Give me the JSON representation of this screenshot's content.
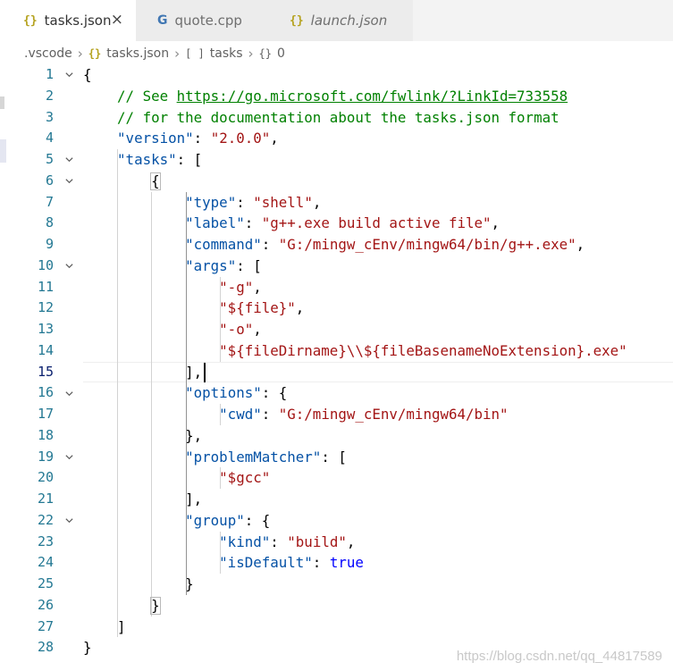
{
  "tabs": [
    {
      "label": "tasks.json",
      "icon": "{}",
      "icon_name": "json-file-icon",
      "active": true,
      "italic": false,
      "close": "×"
    },
    {
      "label": "quote.cpp",
      "icon": "G",
      "icon_name": "cpp-file-icon",
      "active": false,
      "italic": false
    },
    {
      "label": "launch.json",
      "icon": "{}",
      "icon_name": "json-file-icon",
      "active": false,
      "italic": true
    }
  ],
  "breadcrumb": [
    {
      "label": ".vscode",
      "icon": ""
    },
    {
      "label": "tasks.json",
      "icon": "{}"
    },
    {
      "label": "tasks",
      "icon": "[ ]"
    },
    {
      "label": "0",
      "icon": "{}"
    }
  ],
  "editor": {
    "current_line": 15,
    "lines": [
      {
        "n": "1",
        "fold": true,
        "tokens": [
          [
            "p",
            "{"
          ]
        ]
      },
      {
        "n": "2",
        "fold": false,
        "tokens": [
          [
            "p",
            "    "
          ],
          [
            "c",
            "// See "
          ],
          [
            "cl",
            "https://go.microsoft.com/fwlink/?LinkId=733558"
          ]
        ]
      },
      {
        "n": "3",
        "fold": false,
        "tokens": [
          [
            "p",
            "    "
          ],
          [
            "c",
            "// for the documentation about the tasks.json format"
          ]
        ]
      },
      {
        "n": "4",
        "fold": false,
        "tokens": [
          [
            "p",
            "    "
          ],
          [
            "k",
            "\"version\""
          ],
          [
            "p",
            ": "
          ],
          [
            "s",
            "\"2.0.0\""
          ],
          [
            "p",
            ","
          ]
        ]
      },
      {
        "n": "5",
        "fold": true,
        "tokens": [
          [
            "p",
            "    "
          ],
          [
            "k",
            "\"tasks\""
          ],
          [
            "p",
            ": ["
          ]
        ]
      },
      {
        "n": "6",
        "fold": true,
        "tokens": [
          [
            "p",
            "        {"
          ]
        ]
      },
      {
        "n": "7",
        "fold": false,
        "tokens": [
          [
            "p",
            "            "
          ],
          [
            "k",
            "\"type\""
          ],
          [
            "p",
            ": "
          ],
          [
            "s",
            "\"shell\""
          ],
          [
            "p",
            ","
          ]
        ]
      },
      {
        "n": "8",
        "fold": false,
        "tokens": [
          [
            "p",
            "            "
          ],
          [
            "k",
            "\"label\""
          ],
          [
            "p",
            ": "
          ],
          [
            "s",
            "\"g++.exe build active file\""
          ],
          [
            "p",
            ","
          ]
        ]
      },
      {
        "n": "9",
        "fold": false,
        "tokens": [
          [
            "p",
            "            "
          ],
          [
            "k",
            "\"command\""
          ],
          [
            "p",
            ": "
          ],
          [
            "s",
            "\"G:/mingw_cEnv/mingw64/bin/g++.exe\""
          ],
          [
            "p",
            ","
          ]
        ]
      },
      {
        "n": "10",
        "fold": true,
        "tokens": [
          [
            "p",
            "            "
          ],
          [
            "k",
            "\"args\""
          ],
          [
            "p",
            ": ["
          ]
        ]
      },
      {
        "n": "11",
        "fold": false,
        "tokens": [
          [
            "p",
            "                "
          ],
          [
            "s",
            "\"-g\""
          ],
          [
            "p",
            ","
          ]
        ]
      },
      {
        "n": "12",
        "fold": false,
        "tokens": [
          [
            "p",
            "                "
          ],
          [
            "s",
            "\"${file}\""
          ],
          [
            "p",
            ","
          ]
        ]
      },
      {
        "n": "13",
        "fold": false,
        "tokens": [
          [
            "p",
            "                "
          ],
          [
            "s",
            "\"-o\""
          ],
          [
            "p",
            ","
          ]
        ]
      },
      {
        "n": "14",
        "fold": false,
        "tokens": [
          [
            "p",
            "                "
          ],
          [
            "s",
            "\"${fileDirname}\\\\${fileBasenameNoExtension}.exe\""
          ]
        ]
      },
      {
        "n": "15",
        "fold": false,
        "tokens": [
          [
            "p",
            "            ],"
          ]
        ]
      },
      {
        "n": "16",
        "fold": true,
        "tokens": [
          [
            "p",
            "            "
          ],
          [
            "k",
            "\"options\""
          ],
          [
            "p",
            ": {"
          ]
        ]
      },
      {
        "n": "17",
        "fold": false,
        "tokens": [
          [
            "p",
            "                "
          ],
          [
            "k",
            "\"cwd\""
          ],
          [
            "p",
            ": "
          ],
          [
            "s",
            "\"G:/mingw_cEnv/mingw64/bin\""
          ]
        ]
      },
      {
        "n": "18",
        "fold": false,
        "tokens": [
          [
            "p",
            "            },"
          ]
        ]
      },
      {
        "n": "19",
        "fold": true,
        "tokens": [
          [
            "p",
            "            "
          ],
          [
            "k",
            "\"problemMatcher\""
          ],
          [
            "p",
            ": ["
          ]
        ]
      },
      {
        "n": "20",
        "fold": false,
        "tokens": [
          [
            "p",
            "                "
          ],
          [
            "s",
            "\"$gcc\""
          ]
        ]
      },
      {
        "n": "21",
        "fold": false,
        "tokens": [
          [
            "p",
            "            ],"
          ]
        ]
      },
      {
        "n": "22",
        "fold": true,
        "tokens": [
          [
            "p",
            "            "
          ],
          [
            "k",
            "\"group\""
          ],
          [
            "p",
            ": {"
          ]
        ]
      },
      {
        "n": "23",
        "fold": false,
        "tokens": [
          [
            "p",
            "                "
          ],
          [
            "k",
            "\"kind\""
          ],
          [
            "p",
            ": "
          ],
          [
            "s",
            "\"build\""
          ],
          [
            "p",
            ","
          ]
        ]
      },
      {
        "n": "24",
        "fold": false,
        "tokens": [
          [
            "p",
            "                "
          ],
          [
            "k",
            "\"isDefault\""
          ],
          [
            "p",
            ": "
          ],
          [
            "b",
            "true"
          ]
        ]
      },
      {
        "n": "25",
        "fold": false,
        "tokens": [
          [
            "p",
            "            }"
          ]
        ]
      },
      {
        "n": "26",
        "fold": false,
        "tokens": [
          [
            "p",
            "        }"
          ]
        ]
      },
      {
        "n": "27",
        "fold": false,
        "tokens": [
          [
            "p",
            "    ]"
          ]
        ]
      },
      {
        "n": "28",
        "fold": false,
        "tokens": [
          [
            "p",
            "}"
          ]
        ]
      }
    ]
  },
  "watermark": "https://blog.csdn.net/qq_44817589",
  "colors": {
    "key": "#0451a5",
    "string": "#a31515",
    "comment": "#008000",
    "keyword": "#0000ff",
    "line_number": "#237893"
  }
}
